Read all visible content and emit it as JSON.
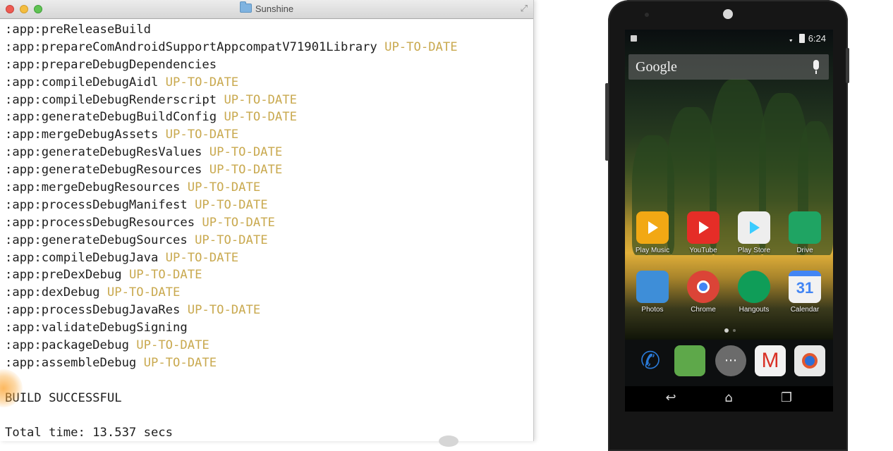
{
  "window": {
    "title": "Sunshine",
    "icons": {
      "folder": "folder-icon",
      "fullscreen": "fullscreen-icon"
    }
  },
  "terminal": {
    "lines": [
      {
        "task": ":app:preReleaseBuild",
        "status": ""
      },
      {
        "task": ":app:prepareComAndroidSupportAppcompatV71901Library",
        "status": "UP-TO-DATE"
      },
      {
        "task": ":app:prepareDebugDependencies",
        "status": ""
      },
      {
        "task": ":app:compileDebugAidl",
        "status": "UP-TO-DATE"
      },
      {
        "task": ":app:compileDebugRenderscript",
        "status": "UP-TO-DATE"
      },
      {
        "task": ":app:generateDebugBuildConfig",
        "status": "UP-TO-DATE"
      },
      {
        "task": ":app:mergeDebugAssets",
        "status": "UP-TO-DATE"
      },
      {
        "task": ":app:generateDebugResValues",
        "status": "UP-TO-DATE"
      },
      {
        "task": ":app:generateDebugResources",
        "status": "UP-TO-DATE"
      },
      {
        "task": ":app:mergeDebugResources",
        "status": "UP-TO-DATE"
      },
      {
        "task": ":app:processDebugManifest",
        "status": "UP-TO-DATE"
      },
      {
        "task": ":app:processDebugResources",
        "status": "UP-TO-DATE"
      },
      {
        "task": ":app:generateDebugSources",
        "status": "UP-TO-DATE"
      },
      {
        "task": ":app:compileDebugJava",
        "status": "UP-TO-DATE"
      },
      {
        "task": ":app:preDexDebug",
        "status": "UP-TO-DATE"
      },
      {
        "task": ":app:dexDebug",
        "status": "UP-TO-DATE"
      },
      {
        "task": ":app:processDebugJavaRes",
        "status": "UP-TO-DATE"
      },
      {
        "task": ":app:validateDebugSigning",
        "status": ""
      },
      {
        "task": ":app:packageDebug",
        "status": "UP-TO-DATE"
      },
      {
        "task": ":app:assembleDebug",
        "status": "UP-TO-DATE"
      },
      {
        "task": "",
        "status": ""
      },
      {
        "task": "BUILD SUCCESSFUL",
        "status": ""
      },
      {
        "task": "",
        "status": ""
      },
      {
        "task": "Total time: 13.537 secs",
        "status": ""
      }
    ],
    "colors": {
      "text": "#1e1e1e",
      "status": "#c9a94f"
    }
  },
  "phone": {
    "status_bar": {
      "time": "6:24",
      "icons": [
        "notification-icon",
        "wifi-icon",
        "battery-icon"
      ]
    },
    "search": {
      "label": "Google",
      "icon": "mic-icon"
    },
    "apps": [
      {
        "label": "Play Music",
        "icon": "play-music-icon",
        "color": "#f2a814"
      },
      {
        "label": "YouTube",
        "icon": "youtube-icon",
        "color": "#e52d27"
      },
      {
        "label": "Play Store",
        "icon": "play-store-icon",
        "color": "#eeeeee"
      },
      {
        "label": "Drive",
        "icon": "drive-icon",
        "color": "#1fa463"
      },
      {
        "label": "Photos",
        "icon": "photos-icon",
        "color": "#3e8ed8"
      },
      {
        "label": "Chrome",
        "icon": "chrome-icon",
        "color": "#db4437"
      },
      {
        "label": "Hangouts",
        "icon": "hangouts-icon",
        "color": "#0f9d58"
      },
      {
        "label": "Calendar",
        "icon": "calendar-icon",
        "color": "#4285f4"
      }
    ],
    "calendar_day": "31",
    "dock": [
      {
        "icon": "phone-icon",
        "color": "#2a7ad8"
      },
      {
        "icon": "maps-icon",
        "color": "#5ea84a"
      },
      {
        "icon": "app-drawer-icon",
        "color": "#6b6b6b"
      },
      {
        "icon": "gmail-icon",
        "color": "#f2f2f2"
      },
      {
        "icon": "camera-icon",
        "color": "#e8e8e8"
      }
    ],
    "nav": [
      "back-icon",
      "home-icon",
      "recents-icon"
    ]
  }
}
